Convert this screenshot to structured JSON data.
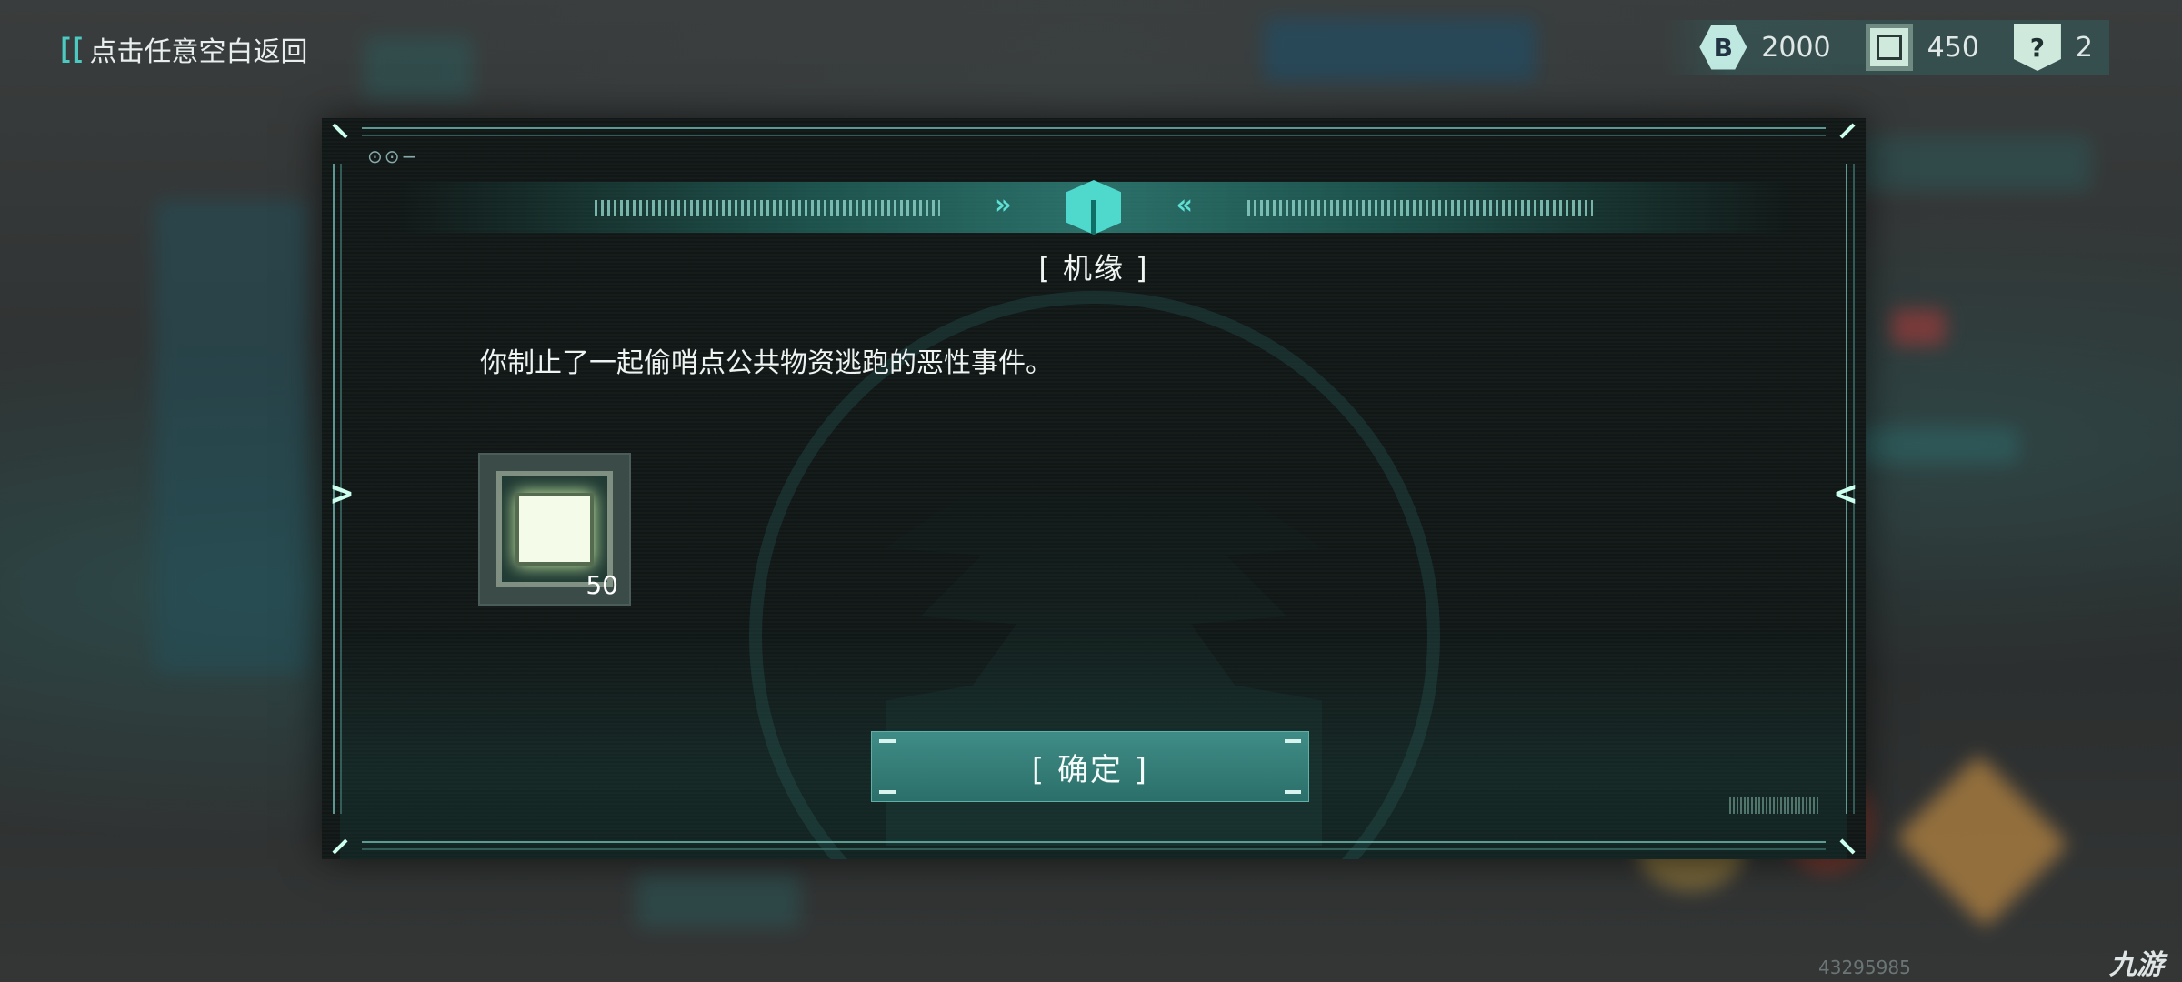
{
  "topbar": {
    "back_label": "点击任意空白返回",
    "back_icon": "bracket-back-icon"
  },
  "resources": [
    {
      "icon": "coin-b-icon",
      "glyph": "B",
      "value": "2000"
    },
    {
      "icon": "crate-icon",
      "value": "450"
    },
    {
      "icon": "question-card-icon",
      "glyph": "?",
      "value": "2"
    }
  ],
  "dialog": {
    "header_icon": "box-icon",
    "title": "[ 机缘 ]",
    "message": "你制止了一起偷哨点公共物资逃跑的恶性事件。",
    "reward": {
      "icon": "crate-icon",
      "count": "50"
    },
    "confirm_label": "[ 确定 ]"
  },
  "footer": {
    "id": "43295985",
    "watermark": "九游"
  },
  "colors": {
    "accent": "#4fd9cc",
    "button": "#2c6f6a",
    "dialog_bg": "#101716"
  }
}
